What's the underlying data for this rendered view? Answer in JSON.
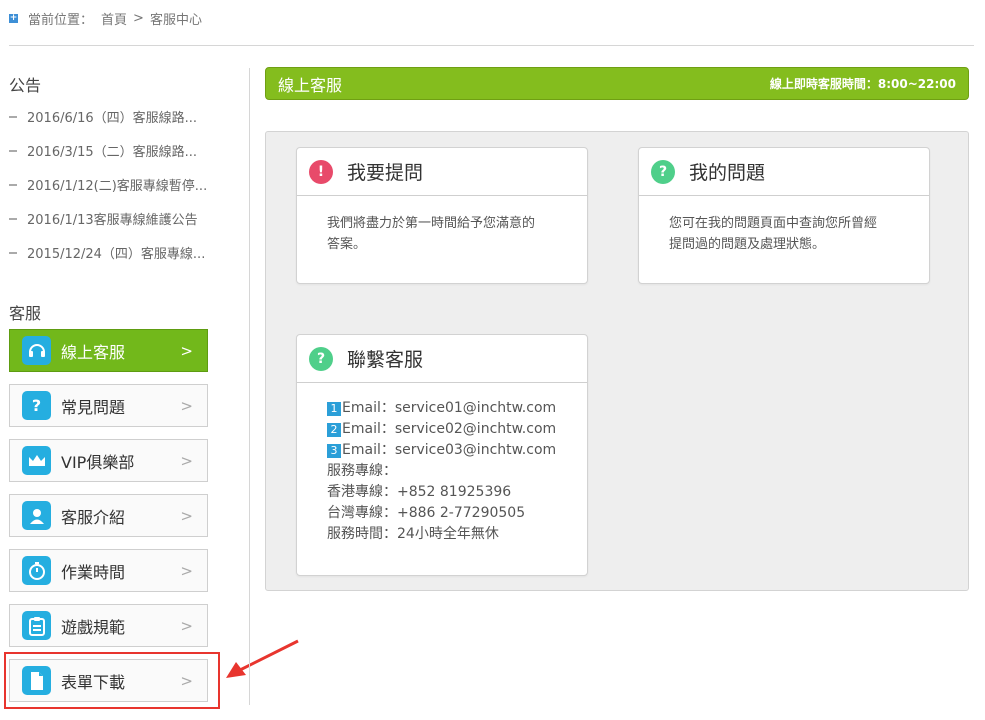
{
  "breadcrumb": {
    "icon": "plus-square-icon",
    "prefix": "當前位置：",
    "home": "首頁",
    "separator": ">",
    "current": "客服中心"
  },
  "sidebar": {
    "notice_title": "公告",
    "notices": [
      "2016/6/16（四）客服線路...",
      "2016/3/15（二）客服線路...",
      "2016/1/12(二)客服專線暫停...",
      "2016/1/13客服專線維護公告",
      "2015/12/24（四）客服專線..."
    ],
    "service_title": "客服",
    "menu": [
      {
        "label": "線上客服",
        "icon": "headset-icon",
        "arrow": ">"
      },
      {
        "label": "常見問題",
        "icon": "question-icon",
        "arrow": ">"
      },
      {
        "label": "VIP俱樂部",
        "icon": "crown-icon",
        "arrow": ">"
      },
      {
        "label": "客服介紹",
        "icon": "agent-icon",
        "arrow": ">"
      },
      {
        "label": "作業時間",
        "icon": "stopwatch-icon",
        "arrow": ">"
      },
      {
        "label": "遊戲規範",
        "icon": "clipboard-icon",
        "arrow": ">"
      },
      {
        "label": "表單下載",
        "icon": "document-icon",
        "arrow": ">"
      }
    ]
  },
  "header": {
    "title": "線上客服",
    "hours": "線上即時客服時間：8:00~22:00"
  },
  "cards": {
    "ask": {
      "title": "我要提問",
      "icon": "exclamation-circle-icon",
      "line1": "我們將盡力於第一時間給予您滿意的",
      "line2": "答案。"
    },
    "mine": {
      "title": "我的問題",
      "icon": "question-circle-icon",
      "line1": "您可在我的問題頁面中查詢您所曾經",
      "line2": "提問過的問題及處理狀態。"
    },
    "contact": {
      "title": "聯繫客服",
      "icon": "question-circle-icon",
      "emails": [
        {
          "num": "1",
          "text": "Email：service01@inchtw.com"
        },
        {
          "num": "2",
          "text": "Email：service02@inchtw.com"
        },
        {
          "num": "3",
          "text": "Email：service03@inchtw.com"
        }
      ],
      "hotline_label": "服務專線：",
      "hk": "香港專線：+852 81925396",
      "tw": "台灣專線：+886 2-77290505",
      "hours": "服務時間：24小時全年無休"
    }
  },
  "colors": {
    "accent_green": "#84bd1e",
    "icon_blue": "#25aee0",
    "alert_red": "#e84a6a",
    "help_green": "#4fcf8a",
    "highlight_red": "#e8352e"
  }
}
